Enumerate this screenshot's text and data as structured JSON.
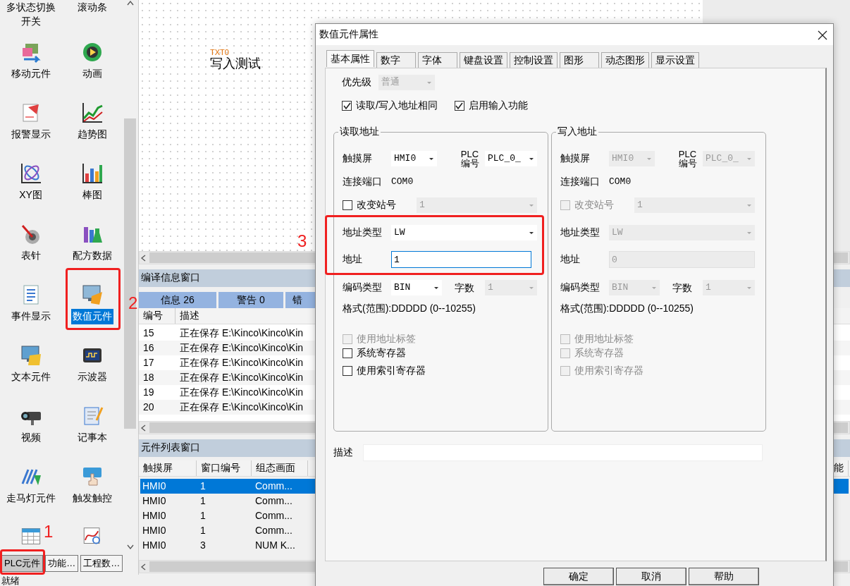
{
  "palette": {
    "items": [
      {
        "kind": "label_only",
        "label": "多状态切换开关",
        "selected": false
      },
      {
        "kind": "label_only",
        "label": "滚动条",
        "selected": false
      },
      {
        "label": "移动元件",
        "selected": false
      },
      {
        "label": "动画",
        "selected": false
      },
      {
        "label": "报警显示",
        "selected": false
      },
      {
        "label": "趋势图",
        "selected": false
      },
      {
        "label": "XY图",
        "selected": false
      },
      {
        "label": "棒图",
        "selected": false
      },
      {
        "label": "表针",
        "selected": false
      },
      {
        "label": "配方数据",
        "selected": false
      },
      {
        "label": "事件显示",
        "selected": false
      },
      {
        "label": "数值元件",
        "selected": true
      },
      {
        "label": "文本元件",
        "selected": false
      },
      {
        "label": "示波器",
        "selected": false
      },
      {
        "label": "视频",
        "selected": false
      },
      {
        "label": "记事本",
        "selected": false
      },
      {
        "label": "走马灯元件",
        "selected": false
      },
      {
        "label": "触发触控",
        "selected": false
      },
      {
        "kind": "icon_only"
      },
      {
        "kind": "icon_only"
      }
    ],
    "tabs": [
      {
        "label": "PLC元件",
        "selected": true
      },
      {
        "label": "功能…",
        "selected": false
      },
      {
        "label": "工程数…",
        "selected": false
      }
    ]
  },
  "canvas": {
    "elements": [
      {
        "tag": "TXT0",
        "text": "写入测试"
      }
    ]
  },
  "compile_window": {
    "title": "编译信息窗口",
    "tabs": [
      "信息 26",
      "警告 0",
      "错"
    ],
    "columns": [
      "编号",
      "描述"
    ],
    "rows": [
      [
        "15",
        "正在保存 E:\\Kinco\\Kinco\\Kin"
      ],
      [
        "16",
        "正在保存 E:\\Kinco\\Kinco\\Kin"
      ],
      [
        "17",
        "正在保存 E:\\Kinco\\Kinco\\Kin"
      ],
      [
        "18",
        "正在保存 E:\\Kinco\\Kinco\\Kin"
      ],
      [
        "19",
        "正在保存 E:\\Kinco\\Kinco\\Kin"
      ],
      [
        "20",
        "正在保存 E:\\Kinco\\Kinco\\Kin"
      ]
    ]
  },
  "element_list": {
    "title": "元件列表窗口",
    "columns": [
      "触摸屏",
      "窗口编号",
      "组态画面"
    ],
    "column_5": "能",
    "rows": [
      {
        "cells": [
          "HMI0",
          "1",
          "Comm..."
        ],
        "selected": true
      },
      {
        "cells": [
          "HMI0",
          "1",
          "Comm..."
        ],
        "selected": false
      },
      {
        "cells": [
          "HMI0",
          "1",
          "Comm..."
        ],
        "selected": false
      },
      {
        "cells": [
          "HMI0",
          "1",
          "Comm..."
        ],
        "selected": false
      },
      {
        "cells": [
          "HMI0",
          "3",
          "NUM K..."
        ],
        "selected": false
      }
    ]
  },
  "status_bar": "就绪",
  "dialog": {
    "title": "数值元件属性",
    "tabs": [
      {
        "label": "基本属性",
        "selected": true
      },
      {
        "label": "数字",
        "selected": false
      },
      {
        "label": "字体",
        "selected": false
      },
      {
        "label": "键盘设置",
        "selected": false
      },
      {
        "label": "控制设置",
        "selected": false
      },
      {
        "label": "图形",
        "selected": false
      },
      {
        "label": "动态图形",
        "selected": false
      },
      {
        "label": "显示设置",
        "selected": false
      }
    ],
    "priority": {
      "label": "优先级",
      "value": "普通",
      "disabled": true
    },
    "options": [
      {
        "label": "读取/写入地址相同",
        "checked": true
      },
      {
        "label": "启用输入功能",
        "checked": true
      }
    ],
    "groups": [
      {
        "title": "读取地址",
        "hmi": {
          "label": "触摸屏",
          "value": "HMI0",
          "disabled": false
        },
        "plc": {
          "label": "PLC\n编号",
          "value": "PLC_0_",
          "disabled": false
        },
        "port": {
          "label": "连接端口",
          "value": "COM0"
        },
        "station": {
          "label": "改变站号",
          "checked": false,
          "disabled": false,
          "value": "1",
          "value_disabled": true
        },
        "address_type": {
          "label": "地址类型",
          "value": "LW",
          "disabled": false
        },
        "address": {
          "label": "地址",
          "value": "1",
          "disabled": false,
          "focused": true
        },
        "encoding": {
          "label": "编码类型",
          "value": "BIN",
          "disabled": false
        },
        "word_count": {
          "label": "字数",
          "value": "1",
          "disabled": true
        },
        "format": "格式(范围):DDDDD (0--10255)",
        "checks": [
          {
            "label": "使用地址标签",
            "checked": false,
            "disabled": true
          },
          {
            "label": "系统寄存器",
            "checked": false,
            "disabled": false
          },
          {
            "label": "使用索引寄存器",
            "checked": false,
            "disabled": false
          }
        ]
      },
      {
        "title": "写入地址",
        "hmi": {
          "label": "触摸屏",
          "value": "HMI0",
          "disabled": true
        },
        "plc": {
          "label": "PLC\n编号",
          "value": "PLC_0_",
          "disabled": true
        },
        "port": {
          "label": "连接端口",
          "value": "COM0"
        },
        "station": {
          "label": "改变站号",
          "checked": false,
          "disabled": true,
          "value": "1",
          "value_disabled": true
        },
        "address_type": {
          "label": "地址类型",
          "value": "LW",
          "disabled": true
        },
        "address": {
          "label": "地址",
          "value": "0",
          "disabled": true,
          "focused": false
        },
        "encoding": {
          "label": "编码类型",
          "value": "BIN",
          "disabled": true
        },
        "word_count": {
          "label": "字数",
          "value": "1",
          "disabled": true
        },
        "format": "格式(范围):DDDDD (0--10255)",
        "checks": [
          {
            "label": "使用地址标签",
            "checked": false,
            "disabled": true
          },
          {
            "label": "系统寄存器",
            "checked": false,
            "disabled": true
          },
          {
            "label": "使用索引寄存器",
            "checked": false,
            "disabled": true
          }
        ]
      }
    ],
    "description": {
      "label": "描述"
    },
    "buttons": [
      "确定",
      "取消",
      "帮助"
    ]
  },
  "annotations": [
    {
      "number": "1"
    },
    {
      "number": "2"
    },
    {
      "number": "3"
    }
  ]
}
